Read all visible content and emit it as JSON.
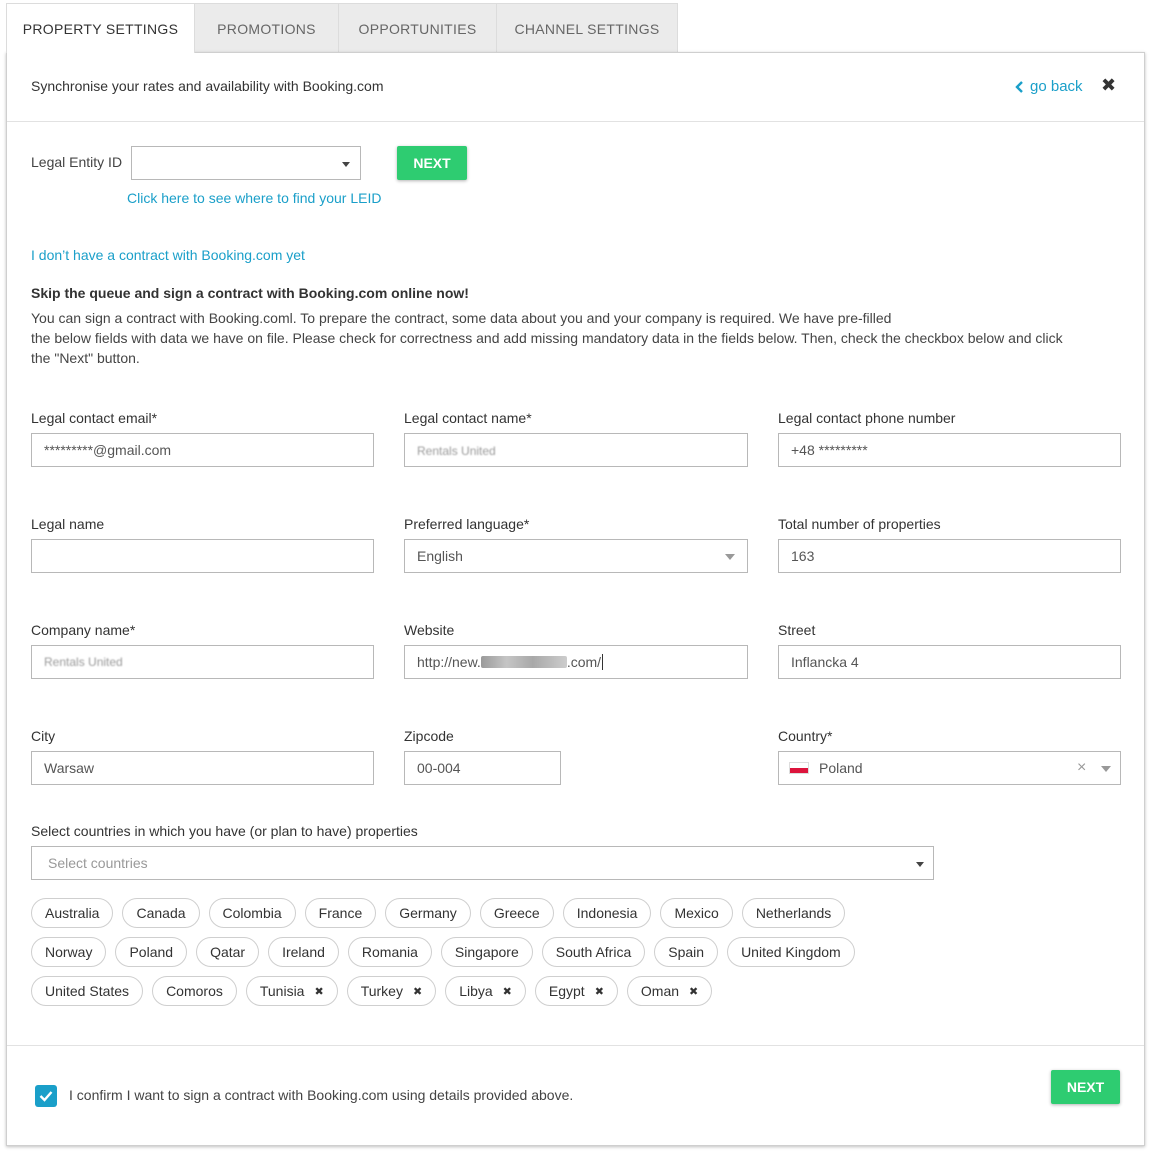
{
  "tabs": [
    {
      "label": "PROPERTY SETTINGS",
      "active": true
    },
    {
      "label": "PROMOTIONS",
      "active": false
    },
    {
      "label": "OPPORTUNITIES",
      "active": false
    },
    {
      "label": "CHANNEL SETTINGS",
      "active": false
    }
  ],
  "header": {
    "title": "Synchronise your rates and availability with Booking.com",
    "go_back": "go back",
    "close": "✖"
  },
  "leid": {
    "label": "Legal Entity ID",
    "value": "",
    "next_button": "NEXT",
    "help_link": "Click here to see where to find your LEID"
  },
  "no_contract_link": "I don’t have a contract with Booking.com yet",
  "intro": {
    "heading": "Skip the queue and sign a contract with Booking.com online now!",
    "line1": "You can sign a contract with Booking.coml. To prepare the contract, some data about you and your company is required. We have pre-filled",
    "line2": "the below fields with data we have on file. Please check for correctness and add missing mandatory data in the fields below. Then, check the checkbox below and click",
    "line3": "the \"Next\" button."
  },
  "fields": {
    "legal_contact_email": {
      "label": "Legal contact email*",
      "value": "*********@gmail.com"
    },
    "legal_contact_name": {
      "label": "Legal contact name*",
      "value": "Rentals United"
    },
    "legal_contact_phone": {
      "label": "Legal contact phone number",
      "value": "+48 *********"
    },
    "legal_name": {
      "label": "Legal name",
      "value": ""
    },
    "preferred_language": {
      "label": "Preferred language*",
      "value": "English"
    },
    "total_properties": {
      "label": "Total number of properties",
      "value": "163"
    },
    "company_name": {
      "label": "Company name*",
      "value": "Rentals United"
    },
    "website": {
      "label": "Website",
      "prefix": "http://new.",
      "suffix": ".com/"
    },
    "street": {
      "label": "Street",
      "value": "Inflancka 4"
    },
    "city": {
      "label": "City",
      "value": "Warsaw"
    },
    "zipcode": {
      "label": "Zipcode",
      "value": "00-004"
    },
    "country": {
      "label": "Country*",
      "value": "Poland",
      "clear": "×"
    }
  },
  "countries_select": {
    "label": "Select countries in which you have (or plan to have) properties",
    "placeholder": "Select countries"
  },
  "country_chips": {
    "row1": [
      "Australia",
      "Canada",
      "Colombia",
      "France",
      "Germany",
      "Greece",
      "Indonesia",
      "Mexico",
      "Netherlands"
    ],
    "row2": [
      "Norway",
      "Poland",
      "Qatar",
      "Ireland",
      "Romania",
      "Singapore",
      "South Africa",
      "Spain",
      "United Kingdom"
    ],
    "row3_plain": [
      "United States",
      "Comoros"
    ],
    "row3_removable": [
      "Tunisia",
      "Turkey",
      "Libya",
      "Egypt",
      "Oman"
    ]
  },
  "confirm": {
    "text": "I confirm I want to sign a contract with Booking.com using details provided above.",
    "checked": true,
    "next_button": "NEXT"
  },
  "colors": {
    "accent": "#1a9fc9",
    "button_green": "#2ecc71"
  }
}
